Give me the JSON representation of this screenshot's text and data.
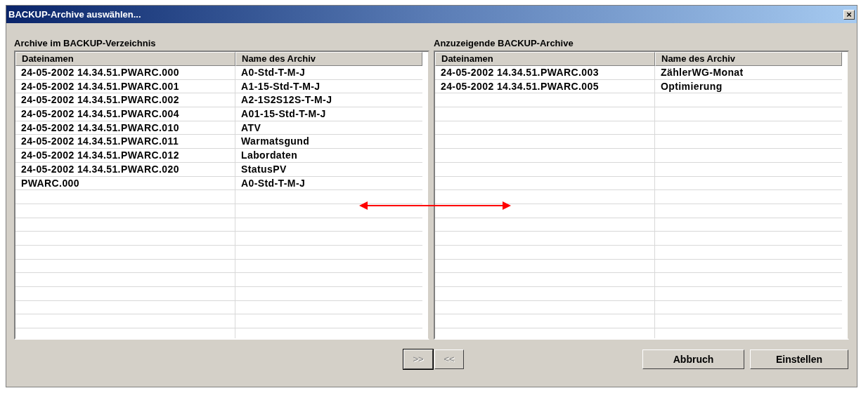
{
  "window": {
    "title": "BACKUP-Archive auswählen...",
    "close": "×"
  },
  "panels": [
    {
      "label": "Archive im BACKUP-Verzeichnis",
      "columns": [
        "Dateinamen",
        "Name des Archiv"
      ],
      "rows": [
        [
          "24-05-2002 14.34.51.PWARC.000",
          "A0-Std-T-M-J"
        ],
        [
          "24-05-2002 14.34.51.PWARC.001",
          "A1-15-Std-T-M-J"
        ],
        [
          "24-05-2002 14.34.51.PWARC.002",
          "A2-1S2S12S-T-M-J"
        ],
        [
          "24-05-2002 14.34.51.PWARC.004",
          "A01-15-Std-T-M-J"
        ],
        [
          "24-05-2002 14.34.51.PWARC.010",
          "ATV"
        ],
        [
          "24-05-2002 14.34.51.PWARC.011",
          "Warmatsgund"
        ],
        [
          "24-05-2002 14.34.51.PWARC.012",
          "Labordaten"
        ],
        [
          "24-05-2002 14.34.51.PWARC.020",
          "StatusPV"
        ],
        [
          "PWARC.000",
          "A0-Std-T-M-J"
        ]
      ]
    },
    {
      "label": "Anzuzeigende BACKUP-Archive",
      "columns": [
        "Dateinamen",
        "Name des Archiv"
      ],
      "rows": [
        [
          "24-05-2002 14.34.51.PWARC.003",
          "ZählerWG-Monat"
        ],
        [
          "24-05-2002 14.34.51.PWARC.005",
          "Optimierung"
        ]
      ]
    }
  ],
  "move_buttons": [
    {
      "label": ">>",
      "disabled": true,
      "focused": true
    },
    {
      "label": "<<",
      "disabled": true,
      "focused": false
    }
  ],
  "buttons": [
    {
      "label": "Abbruch"
    },
    {
      "label": "Einstellen"
    }
  ]
}
